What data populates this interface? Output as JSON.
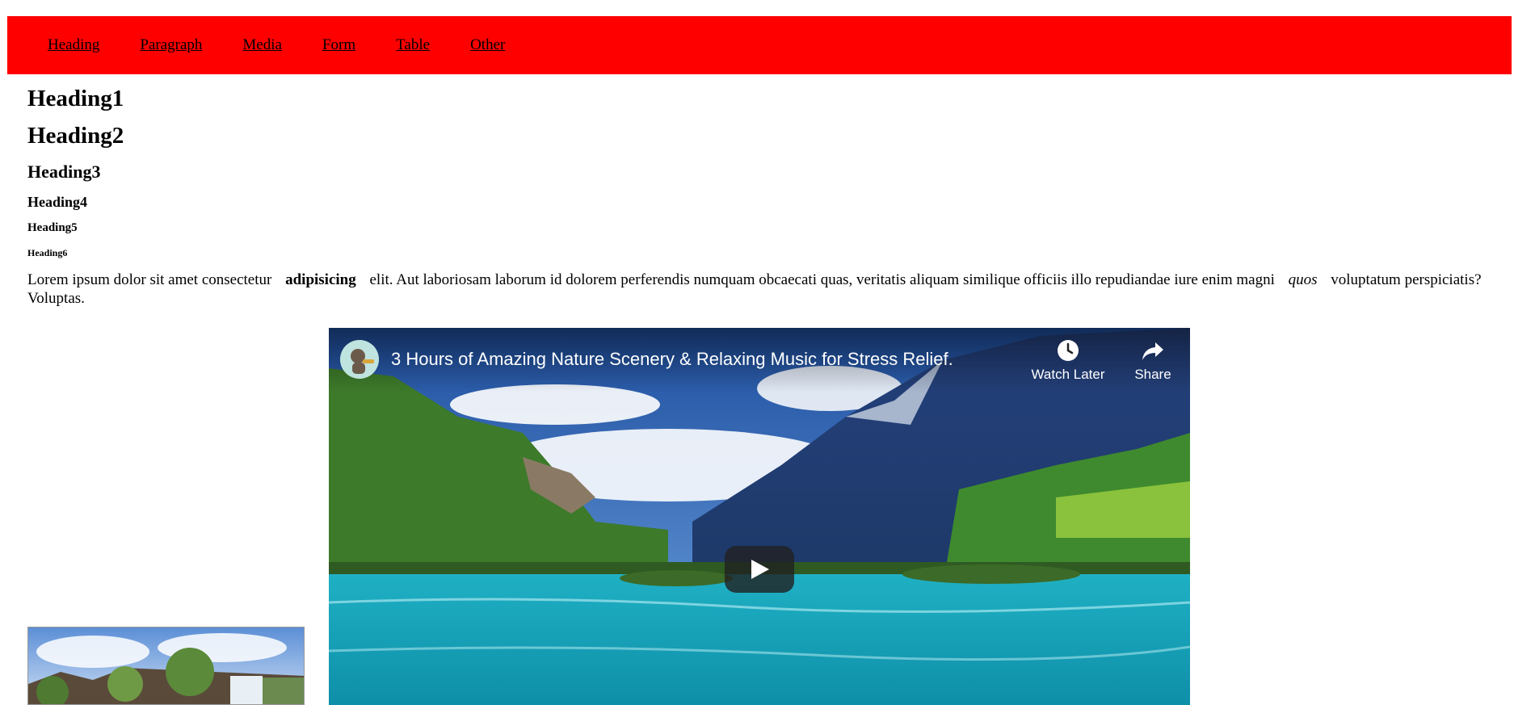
{
  "nav": {
    "items": [
      "Heading",
      "Paragraph",
      "Media",
      "Form",
      "Table",
      "Other"
    ],
    "background": "#ff0000"
  },
  "headings": {
    "h1": "Heading1",
    "h2": "Heading2",
    "h3": "Heading3",
    "h4": "Heading4",
    "h5": "Heading5",
    "h6": "Heading6"
  },
  "paragraph": {
    "part1": "Lorem ipsum dolor sit amet consectetur",
    "bold": "adipisicing",
    "part2": "elit. Aut laboriosam laborum id dolorem perferendis numquam obcaecati quas, veritatis aliquam similique officiis illo repudiandae iure enim magni",
    "italic": "quos",
    "part3": "voluptatum perspiciatis? Voluptas."
  },
  "video": {
    "title": "3 Hours of Amazing Nature Scenery & Relaxing Music for Stress Relief.",
    "watch_later": "Watch Later",
    "share": "Share",
    "icons": {
      "watch_later": "clock-icon",
      "share": "share-arrow-icon",
      "play": "play-icon",
      "avatar": "channel-avatar"
    }
  }
}
